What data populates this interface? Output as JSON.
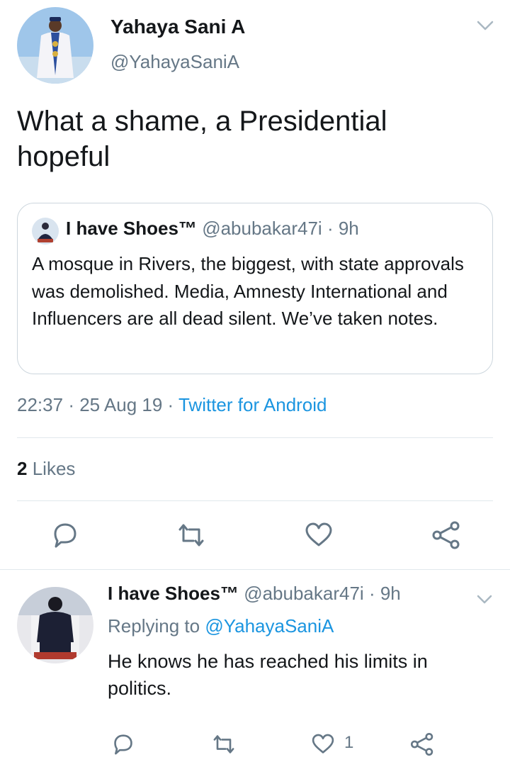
{
  "tweet": {
    "author_name": "Yahaya Sani A",
    "author_handle": "@YahayaSaniA",
    "text": "What a shame, a Presidential hopeful",
    "avatar_icon": "user-avatar-icon",
    "menu_icon": "chevron-down-icon"
  },
  "quoted_tweet": {
    "author_name": "I have Shoes™",
    "author_handle": "@abubakar47i",
    "time": "· 9h",
    "text": "A mosque in Rivers, the biggest, with state approvals was demolished. Media, Amnesty International and Influencers are all dead silent. We’ve taken notes."
  },
  "meta": {
    "time": "22:37",
    "date": "· 25 Aug 19 ·",
    "source": "Twitter for Android"
  },
  "stats": {
    "likes_count": "2",
    "likes_label": "Likes"
  },
  "actions": {
    "reply_icon": "reply-icon",
    "retweet_icon": "retweet-icon",
    "like_icon": "heart-icon",
    "share_icon": "share-icon"
  },
  "reply": {
    "author_name": "I have Shoes™",
    "author_handle": "@abubakar47i",
    "time": "· 9h",
    "replying_prefix": "Replying to",
    "replying_to": "@YahayaSaniA",
    "text": "He knows he has reached his limits in politics.",
    "like_count": "1"
  },
  "colors": {
    "link": "#1b95e0",
    "muted": "#657786",
    "border": "#ccd6dd",
    "divider": "#e1e8ed"
  }
}
